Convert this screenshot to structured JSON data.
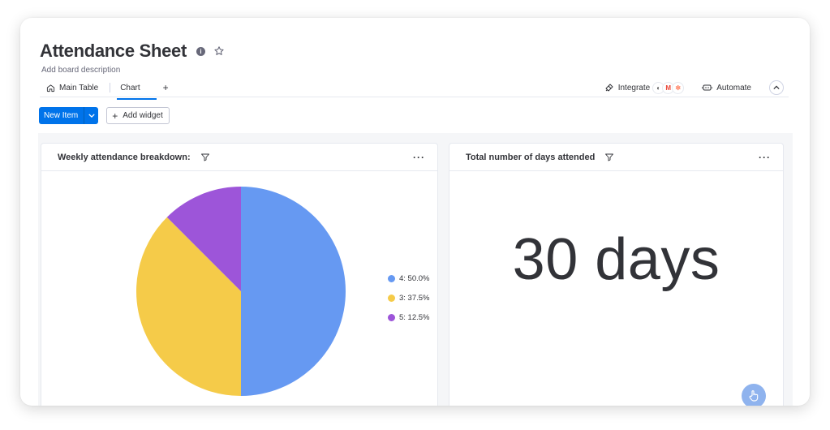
{
  "board": {
    "title": "Attendance Sheet",
    "description": "Add board description"
  },
  "tabs": [
    {
      "label": "Main Table",
      "icon": "home-icon",
      "active": false
    },
    {
      "label": "Chart",
      "active": true
    }
  ],
  "add_tab_label": "+",
  "header_actions": {
    "integrate_label": "Integrate",
    "automate_label": "Automate"
  },
  "toolbar": {
    "new_item_label": "New Item",
    "add_widget_label": "Add widget"
  },
  "widgets": {
    "pie": {
      "title": "Weekly attendance breakdown:",
      "more_label": "···"
    },
    "number": {
      "title": "Total number of days attended",
      "value": "30 days",
      "more_label": "···"
    }
  },
  "chart_data": {
    "type": "pie",
    "slices": [
      {
        "label": "4: 50.0%",
        "value": 50.0,
        "color": "#6699f2"
      },
      {
        "label": "3: 37.5%",
        "value": 37.5,
        "color": "#f5cb49"
      },
      {
        "label": "5: 12.5%",
        "value": 12.5,
        "color": "#9d55d9"
      }
    ],
    "legend_position": "right"
  },
  "colors": {
    "primary": "#0073ea",
    "text": "#323338",
    "canvas": "#f5f6f8"
  }
}
